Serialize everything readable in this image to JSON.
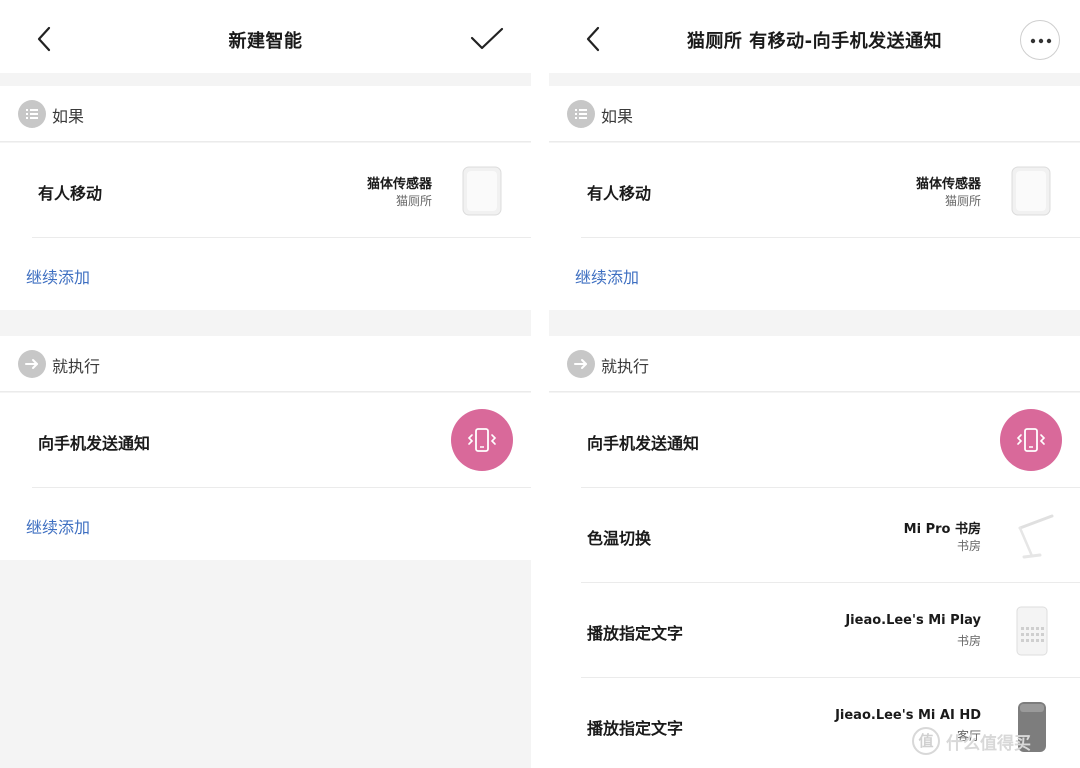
{
  "left": {
    "title": "新建智能",
    "if_section": {
      "label": "如果"
    },
    "if_row": {
      "label": "有人移动",
      "device": "猫体传感器",
      "room": "猫厕所"
    },
    "if_add": "继续添加",
    "then_section": {
      "label": "就执行"
    },
    "then_row": {
      "label": "向手机发送通知"
    },
    "then_add": "继续添加"
  },
  "right": {
    "title": "猫厕所 有移动-向手机发送通知",
    "if_section": {
      "label": "如果"
    },
    "if_row": {
      "label": "有人移动",
      "device": "猫体传感器",
      "room": "猫厕所"
    },
    "if_add": "继续添加",
    "then_section": {
      "label": "就执行"
    },
    "actions": [
      {
        "label": "向手机发送通知"
      },
      {
        "label": "色温切换",
        "device": "Mi Pro  书房",
        "room": "书房"
      },
      {
        "label": "播放指定文字",
        "device": "Jieao.Lee's Mi Play",
        "room": "书房"
      },
      {
        "label": "播放指定文字",
        "device": "Jieao.Lee's Mi AI HD",
        "room": "客厅"
      }
    ]
  },
  "watermark": {
    "badge": "值",
    "text": "什么值得买"
  },
  "colors": {
    "accent_link": "#3e6fc1",
    "notify_pink": "#d9699a",
    "icon_gray": "#c7c7c7",
    "background": "#f4f4f4"
  },
  "icons": [
    "back-chevron-icon",
    "checkmark-icon",
    "more-dots-icon",
    "list-icon",
    "arrow-right-icon",
    "phone-vibrate-icon"
  ]
}
